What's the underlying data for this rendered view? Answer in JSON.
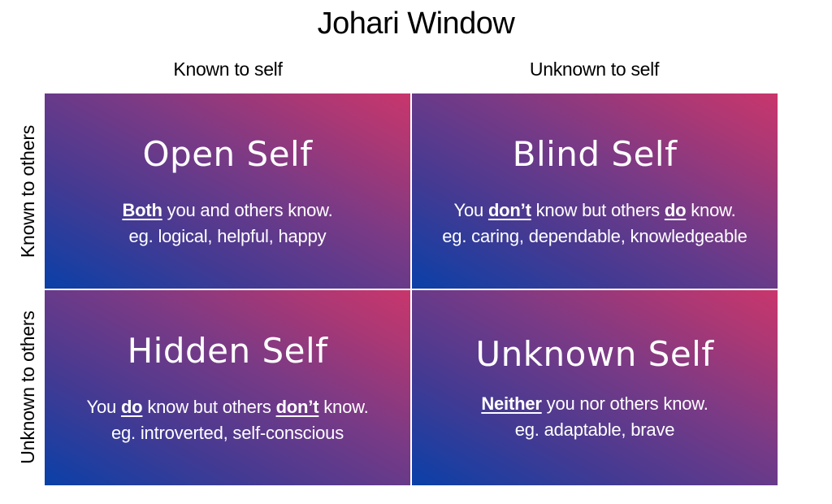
{
  "title": "Johari Window",
  "columns": [
    "Known to self",
    "Unknown to self"
  ],
  "rows": [
    "Known to others",
    "Unknown to others"
  ],
  "colors": {
    "gradient_start": "#0a40a8",
    "gradient_end": "#c9366c",
    "text": "#ffffff"
  },
  "quadrants": [
    {
      "title": "Open Self",
      "desc_parts": [
        {
          "text": "Both",
          "emph": true
        },
        {
          "text": " you and others know.",
          "emph": false
        }
      ],
      "example": "eg. logical, helpful, happy"
    },
    {
      "title": "Blind Self",
      "desc_parts": [
        {
          "text": "You ",
          "emph": false
        },
        {
          "text": "don’t",
          "emph": true
        },
        {
          "text": " know but others ",
          "emph": false
        },
        {
          "text": "do",
          "emph": true
        },
        {
          "text": " know.",
          "emph": false
        }
      ],
      "example": "eg. caring, dependable, knowledgeable"
    },
    {
      "title": "Hidden Self",
      "desc_parts": [
        {
          "text": "You ",
          "emph": false
        },
        {
          "text": "do",
          "emph": true
        },
        {
          "text": " know but others ",
          "emph": false
        },
        {
          "text": "don’t",
          "emph": true
        },
        {
          "text": " know.",
          "emph": false
        }
      ],
      "example": "eg. introverted, self-conscious"
    },
    {
      "title": "Unknown Self",
      "desc_parts": [
        {
          "text": "Neither",
          "emph": true
        },
        {
          "text": " you nor others know.",
          "emph": false
        }
      ],
      "example": "eg. adaptable, brave"
    }
  ]
}
